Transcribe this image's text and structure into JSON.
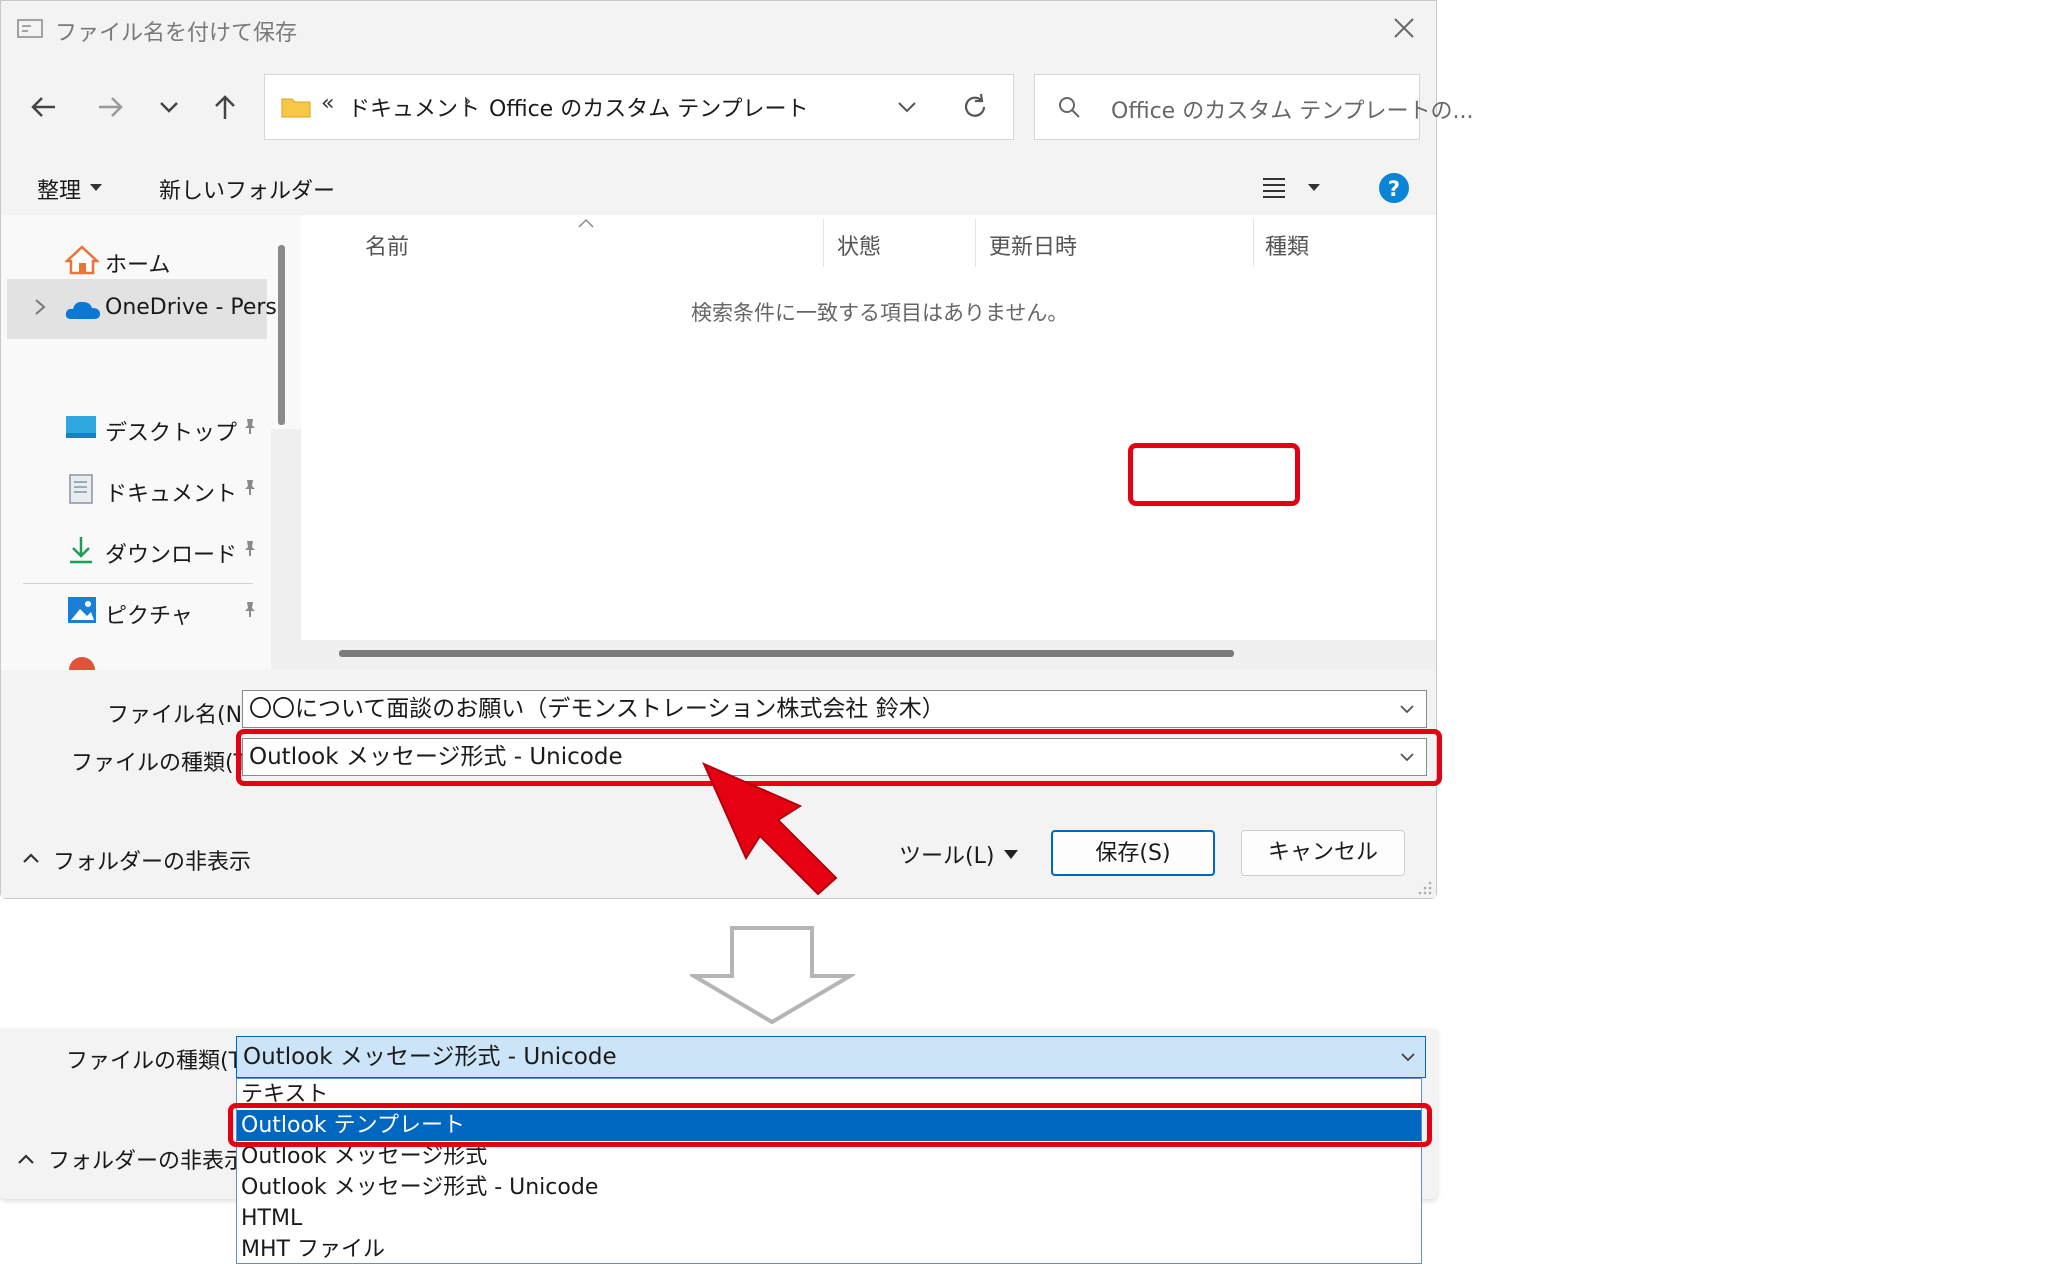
{
  "dialog": {
    "title": "ファイル名を付けて保存",
    "address": {
      "overflow": "«",
      "crumbs": [
        "ドキュメント",
        "Office のカスタム テンプレート"
      ],
      "separator": "›"
    },
    "search_placeholder": "Office のカスタム テンプレートの...",
    "toolbar": {
      "organize_label": "整理",
      "new_folder_label": "新しいフォルダー"
    },
    "sidebar": {
      "items": [
        {
          "label": "ホーム",
          "icon": "home-icon"
        },
        {
          "label": "OneDrive - Pers",
          "icon": "onedrive-cloud-icon"
        },
        {
          "label": "デスクトップ",
          "icon": "desktop-icon"
        },
        {
          "label": "ドキュメント",
          "icon": "documents-icon"
        },
        {
          "label": "ダウンロード",
          "icon": "download-icon"
        },
        {
          "label": "ピクチャ",
          "icon": "pictures-icon"
        }
      ]
    },
    "columns": [
      "名前",
      "状態",
      "更新日時",
      "種類"
    ],
    "empty_message": "検索条件に一致する項目はありません。",
    "filename_label": "ファイル名(N):",
    "filename_value": "〇〇について面談のお願い（デモンストレーション株式会社 鈴木）",
    "filetype_label": "ファイルの種類(T):",
    "filetype_value": "Outlook メッセージ形式 - Unicode",
    "hide_folders_label": "フォルダーの非表示",
    "tools_label": "ツール(L)",
    "save_label": "保存(S)",
    "cancel_label": "キャンセル"
  },
  "lower": {
    "filetype_label": "ファイルの種類(T):",
    "filetype_value": "Outlook メッセージ形式 - Unicode",
    "hide_folders_label": "フォルダーの非表示",
    "options": [
      "テキスト",
      "Outlook テンプレート",
      "Outlook メッセージ形式",
      "Outlook メッセージ形式 - Unicode",
      "HTML",
      "MHT ファイル"
    ],
    "selected_option": "Outlook テンプレート"
  },
  "colors": {
    "highlight": "#e50012",
    "accent": "#0067c0",
    "help": "#0a84d6"
  }
}
